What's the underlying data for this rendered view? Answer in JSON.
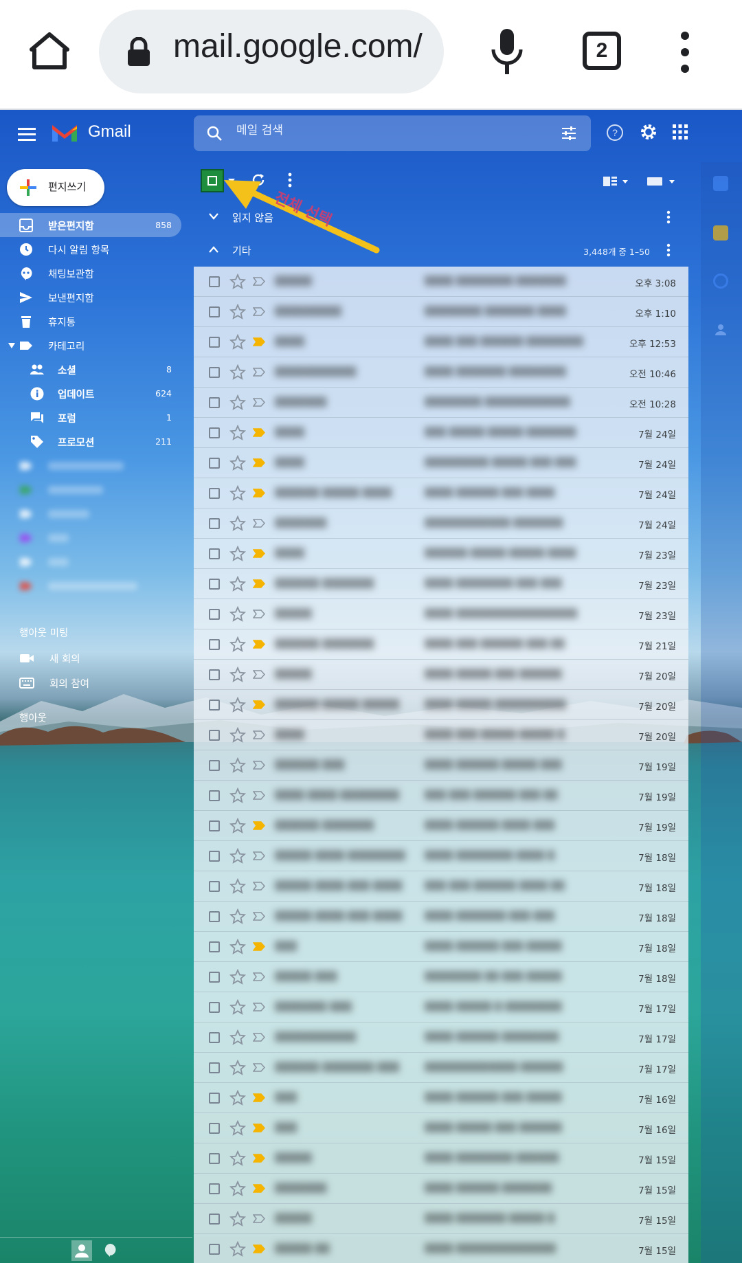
{
  "browser": {
    "url": "mail.google.com/",
    "tab_count": "2"
  },
  "gmail": {
    "brand": "Gmail",
    "search_placeholder": "메일 검색",
    "compose_label": "편지쓰기",
    "nav": [
      {
        "label": "받은편지함",
        "count": "858",
        "icon": "inbox-icon",
        "active": true
      },
      {
        "label": "다시 알림 항목",
        "count": "",
        "icon": "clock-icon"
      },
      {
        "label": "채팅보관함",
        "count": "",
        "icon": "chat-icon"
      },
      {
        "label": "보낸편지함",
        "count": "",
        "icon": "send-icon"
      },
      {
        "label": "휴지통",
        "count": "",
        "icon": "trash-icon"
      },
      {
        "label": "카테고리",
        "count": "",
        "icon": "label-icon"
      }
    ],
    "categories": [
      {
        "label": "소셜",
        "count": "8",
        "icon": "people-icon"
      },
      {
        "label": "업데이트",
        "count": "624",
        "icon": "info-icon"
      },
      {
        "label": "포럼",
        "count": "1",
        "icon": "forum-icon"
      },
      {
        "label": "프로모션",
        "count": "211",
        "icon": "tag-icon"
      }
    ],
    "meet": {
      "title": "행아웃 미팅",
      "new_meeting": "새 회의",
      "join_meeting": "회의 참여"
    },
    "hangouts_title": "행아웃",
    "annotation_text": "전체 선택",
    "sections": {
      "unread": "읽지 않음",
      "other": "기타",
      "range": "3,448개 중 1–50"
    },
    "colors": {
      "accent_select": "#1e8e3e",
      "arrow": "#f4c01a",
      "important_marker": "#f4b400"
    },
    "emails": [
      {
        "sender": "▒▒▒▒▒",
        "subject": "▒▒▒▒ ▒▒▒▒▒▒▒▒ ▒▒▒▒▒▒▒",
        "date": "오후 3:08",
        "important": false
      },
      {
        "sender": "▒▒▒▒▒▒▒▒▒",
        "subject": "▒▒▒▒▒▒▒▒ ▒▒▒▒▒▒▒ ▒▒▒▒",
        "date": "오후 1:10",
        "important": false
      },
      {
        "sender": "▒▒▒▒",
        "subject": "▒▒▒▒ ▒▒▒ ▒▒▒▒▒▒ ▒▒▒▒▒▒▒▒",
        "date": "오후 12:53",
        "important": true
      },
      {
        "sender": "▒▒▒▒▒▒▒▒▒▒▒",
        "subject": "▒▒▒▒ ▒▒▒▒▒▒▒ ▒▒▒▒▒▒▒▒",
        "date": "오전 10:46",
        "important": false
      },
      {
        "sender": "▒▒▒▒▒▒▒",
        "subject": "▒▒▒▒▒▒▒▒ ▒▒▒▒▒▒▒▒▒▒▒▒",
        "date": "오전 10:28",
        "important": false
      },
      {
        "sender": "▒▒▒▒",
        "subject": "▒▒▒ ▒▒▒▒▒ ▒▒▒▒▒ ▒▒▒▒▒▒▒",
        "date": "7월 24일",
        "important": true
      },
      {
        "sender": "▒▒▒▒",
        "subject": "▒▒▒▒▒▒▒▒▒ ▒▒▒▒▒ ▒▒▒ ▒▒▒",
        "date": "7월 24일",
        "important": true
      },
      {
        "sender": "▒▒▒▒▒▒ ▒▒▒▒▒ ▒▒▒▒",
        "subject": "▒▒▒▒ ▒▒▒▒▒▒ ▒▒▒ ▒▒▒▒",
        "date": "7월 24일",
        "important": true
      },
      {
        "sender": "▒▒▒▒▒▒▒",
        "subject": "▒▒▒▒▒▒▒▒▒▒▒▒ ▒▒▒▒▒▒▒",
        "date": "7월 24일",
        "important": false
      },
      {
        "sender": "▒▒▒▒",
        "subject": "▒▒▒▒▒▒ ▒▒▒▒▒ ▒▒▒▒▒ ▒▒▒▒",
        "date": "7월 23일",
        "important": true
      },
      {
        "sender": "▒▒▒▒▒▒ ▒▒▒▒▒▒▒",
        "subject": "▒▒▒▒ ▒▒▒▒▒▒▒▒ ▒▒▒ ▒▒▒",
        "date": "7월 23일",
        "important": true
      },
      {
        "sender": "▒▒▒▒▒",
        "subject": "▒▒▒▒ ▒▒▒▒▒▒▒▒▒▒▒▒▒▒▒▒▒",
        "date": "7월 23일",
        "important": false
      },
      {
        "sender": "▒▒▒▒▒▒ ▒▒▒▒▒▒▒",
        "subject": "▒▒▒▒ ▒▒▒ ▒▒▒▒▒▒ ▒▒▒ ▒▒",
        "date": "7월 21일",
        "important": true
      },
      {
        "sender": "▒▒▒▒▒",
        "subject": "▒▒▒▒ ▒▒▒▒▒ ▒▒▒ ▒▒▒▒▒▒",
        "date": "7월 20일",
        "important": false
      },
      {
        "sender": "▒▒▒▒▒▒ ▒▒▒▒▒ ▒▒▒▒▒",
        "subject": "▒▒▒▒ ▒▒▒▒▒ ▒▒▒▒▒▒▒▒▒▒",
        "date": "7월 20일",
        "important": true
      },
      {
        "sender": "▒▒▒▒",
        "subject": "▒▒▒▒ ▒▒▒ ▒▒▒▒▒ ▒▒▒▒▒ ▒",
        "date": "7월 20일",
        "important": false
      },
      {
        "sender": "▒▒▒▒▒▒ ▒▒▒",
        "subject": "▒▒▒▒ ▒▒▒▒▒▒ ▒▒▒▒▒ ▒▒▒",
        "date": "7월 19일",
        "important": false
      },
      {
        "sender": "▒▒▒▒ ▒▒▒▒ ▒▒▒▒▒▒▒▒",
        "subject": "▒▒▒ ▒▒▒ ▒▒▒▒▒▒ ▒▒▒ ▒▒",
        "date": "7월 19일",
        "important": false
      },
      {
        "sender": "▒▒▒▒▒▒ ▒▒▒▒▒▒▒",
        "subject": "▒▒▒▒ ▒▒▒▒▒▒ ▒▒▒▒ ▒▒▒",
        "date": "7월 19일",
        "important": true
      },
      {
        "sender": "▒▒▒▒▒ ▒▒▒▒ ▒▒▒▒▒▒▒▒",
        "subject": "▒▒▒▒ ▒▒▒▒▒▒▒▒ ▒▒▒▒ ▒",
        "date": "7월 18일",
        "important": false
      },
      {
        "sender": "▒▒▒▒▒ ▒▒▒▒ ▒▒▒ ▒▒▒▒",
        "subject": "▒▒▒ ▒▒▒ ▒▒▒▒▒▒ ▒▒▒▒ ▒▒",
        "date": "7월 18일",
        "important": false
      },
      {
        "sender": "▒▒▒▒▒ ▒▒▒▒ ▒▒▒ ▒▒▒▒",
        "subject": "▒▒▒▒ ▒▒▒▒▒▒▒ ▒▒▒ ▒▒▒",
        "date": "7월 18일",
        "important": false
      },
      {
        "sender": "▒▒▒",
        "subject": "▒▒▒▒ ▒▒▒▒▒▒ ▒▒▒ ▒▒▒▒▒",
        "date": "7월 18일",
        "important": true
      },
      {
        "sender": "▒▒▒▒▒ ▒▒▒",
        "subject": "▒▒▒▒▒▒▒▒ ▒▒ ▒▒▒ ▒▒▒▒▒",
        "date": "7월 18일",
        "important": false
      },
      {
        "sender": "▒▒▒▒▒▒▒ ▒▒▒",
        "subject": "▒▒▒▒ ▒▒▒▒▒ ▒ ▒▒▒▒▒▒▒▒",
        "date": "7월 17일",
        "important": false
      },
      {
        "sender": "▒▒▒▒▒▒▒▒▒▒▒",
        "subject": "▒▒▒▒ ▒▒▒▒▒▒ ▒▒▒▒▒▒▒▒",
        "date": "7월 17일",
        "important": false
      },
      {
        "sender": "▒▒▒▒▒▒ ▒▒▒▒▒▒▒ ▒▒▒",
        "subject": "▒▒▒▒▒▒▒▒▒▒▒▒▒ ▒▒▒▒▒▒",
        "date": "7월 17일",
        "important": false
      },
      {
        "sender": "▒▒▒",
        "subject": "▒▒▒▒ ▒▒▒▒▒▒ ▒▒▒ ▒▒▒▒▒",
        "date": "7월 16일",
        "important": true
      },
      {
        "sender": "▒▒▒",
        "subject": "▒▒▒▒ ▒▒▒▒▒ ▒▒▒ ▒▒▒▒▒▒",
        "date": "7월 16일",
        "important": true
      },
      {
        "sender": "▒▒▒▒▒",
        "subject": "▒▒▒▒ ▒▒▒▒▒▒▒▒ ▒▒▒▒▒▒",
        "date": "7월 15일",
        "important": true
      },
      {
        "sender": "▒▒▒▒▒▒▒",
        "subject": "▒▒▒▒ ▒▒▒▒▒▒ ▒▒▒▒▒▒▒",
        "date": "7월 15일",
        "important": true
      },
      {
        "sender": "▒▒▒▒▒",
        "subject": "▒▒▒▒ ▒▒▒▒▒▒▒ ▒▒▒▒▒ ▒",
        "date": "7월 15일",
        "important": false
      },
      {
        "sender": "▒▒▒▒▒ ▒▒",
        "subject": "▒▒▒▒ ▒▒▒▒▒▒▒▒▒▒▒▒▒▒",
        "date": "7월 15일",
        "important": true
      }
    ]
  }
}
